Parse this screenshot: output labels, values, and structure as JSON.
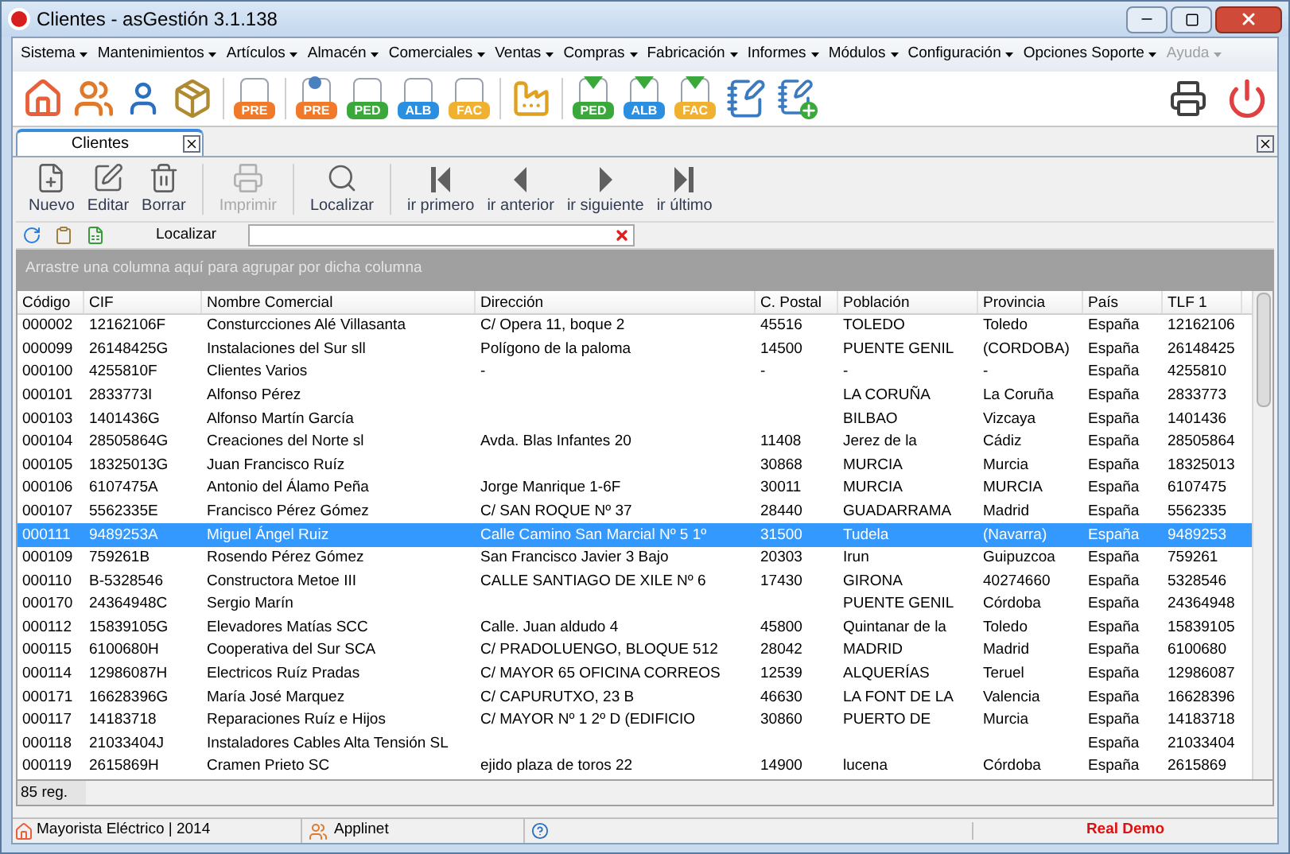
{
  "window": {
    "title": "Clientes - asGestión 3.1.138"
  },
  "menu": [
    {
      "label": "Sistema",
      "disabled": false
    },
    {
      "label": "Mantenimientos",
      "disabled": false
    },
    {
      "label": "Artículos",
      "disabled": false
    },
    {
      "label": "Almacén",
      "disabled": false
    },
    {
      "label": "Comerciales",
      "disabled": false
    },
    {
      "label": "Ventas",
      "disabled": false
    },
    {
      "label": "Compras",
      "disabled": false
    },
    {
      "label": "Fabricación",
      "disabled": false
    },
    {
      "label": "Informes",
      "disabled": false
    },
    {
      "label": "Módulos",
      "disabled": false
    },
    {
      "label": "Configuración",
      "disabled": false
    },
    {
      "label": "Opciones Soporte",
      "disabled": false
    },
    {
      "label": "Ayuda",
      "disabled": true
    }
  ],
  "toolbar": [
    {
      "kind": "home"
    },
    {
      "kind": "people"
    },
    {
      "kind": "person"
    },
    {
      "kind": "box"
    },
    {
      "kind": "doc",
      "label": "PRE",
      "color": "#f07a2a"
    },
    {
      "kind": "doc-person",
      "label": "PRE",
      "color": "#f07a2a"
    },
    {
      "kind": "doc",
      "label": "PED",
      "color": "#3aa83a"
    },
    {
      "kind": "doc",
      "label": "ALB",
      "color": "#2a8fe0"
    },
    {
      "kind": "doc",
      "label": "FAC",
      "color": "#f0b030"
    },
    {
      "kind": "factory"
    },
    {
      "kind": "doc-in",
      "label": "PED",
      "color": "#3aa83a"
    },
    {
      "kind": "doc-in",
      "label": "ALB",
      "color": "#2a8fe0"
    },
    {
      "kind": "doc-in",
      "label": "FAC",
      "color": "#f0b030"
    },
    {
      "kind": "notebook"
    },
    {
      "kind": "notebook-add"
    }
  ],
  "tabs": [
    {
      "label": "Clientes",
      "selected": true
    }
  ],
  "actions": [
    {
      "kind": "new",
      "label": "Nuevo",
      "disabled": false
    },
    {
      "kind": "edit",
      "label": "Editar",
      "disabled": false
    },
    {
      "kind": "delete",
      "label": "Borrar",
      "disabled": false
    },
    {
      "kind": "print",
      "label": "Imprimir",
      "disabled": true
    },
    {
      "kind": "search",
      "label": "Localizar",
      "disabled": false
    },
    {
      "kind": "first",
      "label": "ir primero",
      "disabled": false
    },
    {
      "kind": "prev",
      "label": "ir anterior",
      "disabled": false
    },
    {
      "kind": "next",
      "label": "ir siguiente",
      "disabled": false
    },
    {
      "kind": "last",
      "label": "ir último",
      "disabled": false
    }
  ],
  "find": {
    "label": "Localizar"
  },
  "group_panel": {
    "hint": "Arrastre una columna aquí para agrupar por dicha columna"
  },
  "table": {
    "columns": [
      "Código",
      "CIF",
      "Nombre Comercial",
      "Dirección",
      "C. Postal",
      "Población",
      "Provincia",
      "País",
      "TLF 1"
    ],
    "rows": [
      {
        "cells": [
          "000002",
          "12162106F",
          "Consturcciones Alé Villasanta",
          "C/ Opera 11, boque 2",
          "45516",
          "TOLEDO",
          "Toledo",
          "España",
          "12162106"
        ],
        "selected": false
      },
      {
        "cells": [
          "000099",
          "26148425G",
          "Instalaciones del Sur sll",
          "Polígono de la paloma",
          "14500",
          "PUENTE GENIL",
          "(CORDOBA)",
          "España",
          "26148425"
        ],
        "selected": false
      },
      {
        "cells": [
          "000100",
          "4255810F",
          "Clientes Varios",
          "-",
          "-",
          "-",
          "-",
          "España",
          "4255810"
        ],
        "selected": false
      },
      {
        "cells": [
          "000101",
          "2833773I",
          "Alfonso Pérez",
          "",
          "",
          "LA CORUÑA",
          "La Coruña",
          "España",
          "2833773"
        ],
        "selected": false
      },
      {
        "cells": [
          "000103",
          "1401436G",
          "Alfonso Martín García",
          "",
          "",
          "BILBAO",
          "Vizcaya",
          "España",
          "1401436"
        ],
        "selected": false
      },
      {
        "cells": [
          "000104",
          "28505864G",
          "Creaciones del Norte sl",
          "Avda. Blas Infantes 20",
          "11408",
          "Jerez de la",
          "Cádiz",
          "España",
          "28505864"
        ],
        "selected": false
      },
      {
        "cells": [
          "000105",
          "18325013G",
          "Juan Francisco Ruíz",
          "",
          "30868",
          "MURCIA",
          "Murcia",
          "España",
          "18325013"
        ],
        "selected": false
      },
      {
        "cells": [
          "000106",
          "6107475A",
          "Antonio del Álamo Peña",
          "Jorge Manrique 1-6F",
          "30011",
          "MURCIA",
          "MURCIA",
          "España",
          "6107475"
        ],
        "selected": false
      },
      {
        "cells": [
          "000107",
          "5562335E",
          "Francisco Pérez Gómez",
          "C/ SAN ROQUE Nº 37",
          "28440",
          "GUADARRAMA",
          "Madrid",
          "España",
          "5562335"
        ],
        "selected": false
      },
      {
        "cells": [
          "000111",
          "9489253A",
          "Miguel Ángel Ruiz",
          "Calle Camino San Marcial Nº 5 1º",
          "31500",
          "Tudela",
          "(Navarra)",
          "España",
          "9489253"
        ],
        "selected": true
      },
      {
        "cells": [
          "000109",
          "759261B",
          "Rosendo Pérez Gómez",
          "San Francisco Javier 3 Bajo",
          "20303",
          "Irun",
          "Guipuzcoa",
          "España",
          "759261"
        ],
        "selected": false
      },
      {
        "cells": [
          "000110",
          "B-5328546",
          "Constructora Metoe III",
          "CALLE SANTIAGO DE XILE Nº 6",
          "17430",
          "GIRONA",
          "40274660",
          "España",
          "5328546"
        ],
        "selected": false
      },
      {
        "cells": [
          "000170",
          "24364948C",
          "Sergio Marín",
          "",
          "",
          "PUENTE GENIL",
          "Córdoba",
          "España",
          "24364948"
        ],
        "selected": false
      },
      {
        "cells": [
          "000112",
          "15839105G",
          "Elevadores Matías SCC",
          "Calle. Juan aldudo 4",
          "45800",
          "Quintanar de la",
          "Toledo",
          "España",
          "15839105"
        ],
        "selected": false
      },
      {
        "cells": [
          "000115",
          "6100680H",
          "Cooperativa del Sur SCA",
          "C/ PRADOLUENGO, BLOQUE 512",
          "28042",
          "MADRID",
          "Madrid",
          "España",
          "6100680"
        ],
        "selected": false
      },
      {
        "cells": [
          "000114",
          "12986087H",
          "Electricos Ruíz Pradas",
          "C/ MAYOR 65 OFICINA CORREOS",
          "12539",
          "ALQUERÍAS",
          "Teruel",
          "España",
          "12986087"
        ],
        "selected": false
      },
      {
        "cells": [
          "000171",
          "16628396G",
          "María José Marquez",
          "C/ CAPURUTXO, 23 B",
          "46630",
          "LA FONT DE LA",
          "Valencia",
          "España",
          "16628396"
        ],
        "selected": false
      },
      {
        "cells": [
          "000117",
          "14183718",
          "Reparaciones Ruíz e Hijos",
          "C/ MAYOR Nº 1 2º D (EDIFICIO",
          "30860",
          "PUERTO DE",
          "Murcia",
          "España",
          "14183718"
        ],
        "selected": false
      },
      {
        "cells": [
          "000118",
          "21033404J",
          "Instaladores Cables Alta Tensión SL",
          "",
          "",
          "",
          "",
          "España",
          "21033404"
        ],
        "selected": false
      },
      {
        "cells": [
          "000119",
          "2615869H",
          "Cramen Prieto SC",
          "ejido plaza de toros 22",
          "14900",
          "lucena",
          "Córdoba",
          "España",
          "2615869"
        ],
        "selected": false
      }
    ]
  },
  "footer": {
    "count": "85 reg."
  },
  "status_bar": {
    "company": "Mayorista Eléctrico | 2014",
    "user": "Applinet",
    "mode": "Real Demo"
  }
}
